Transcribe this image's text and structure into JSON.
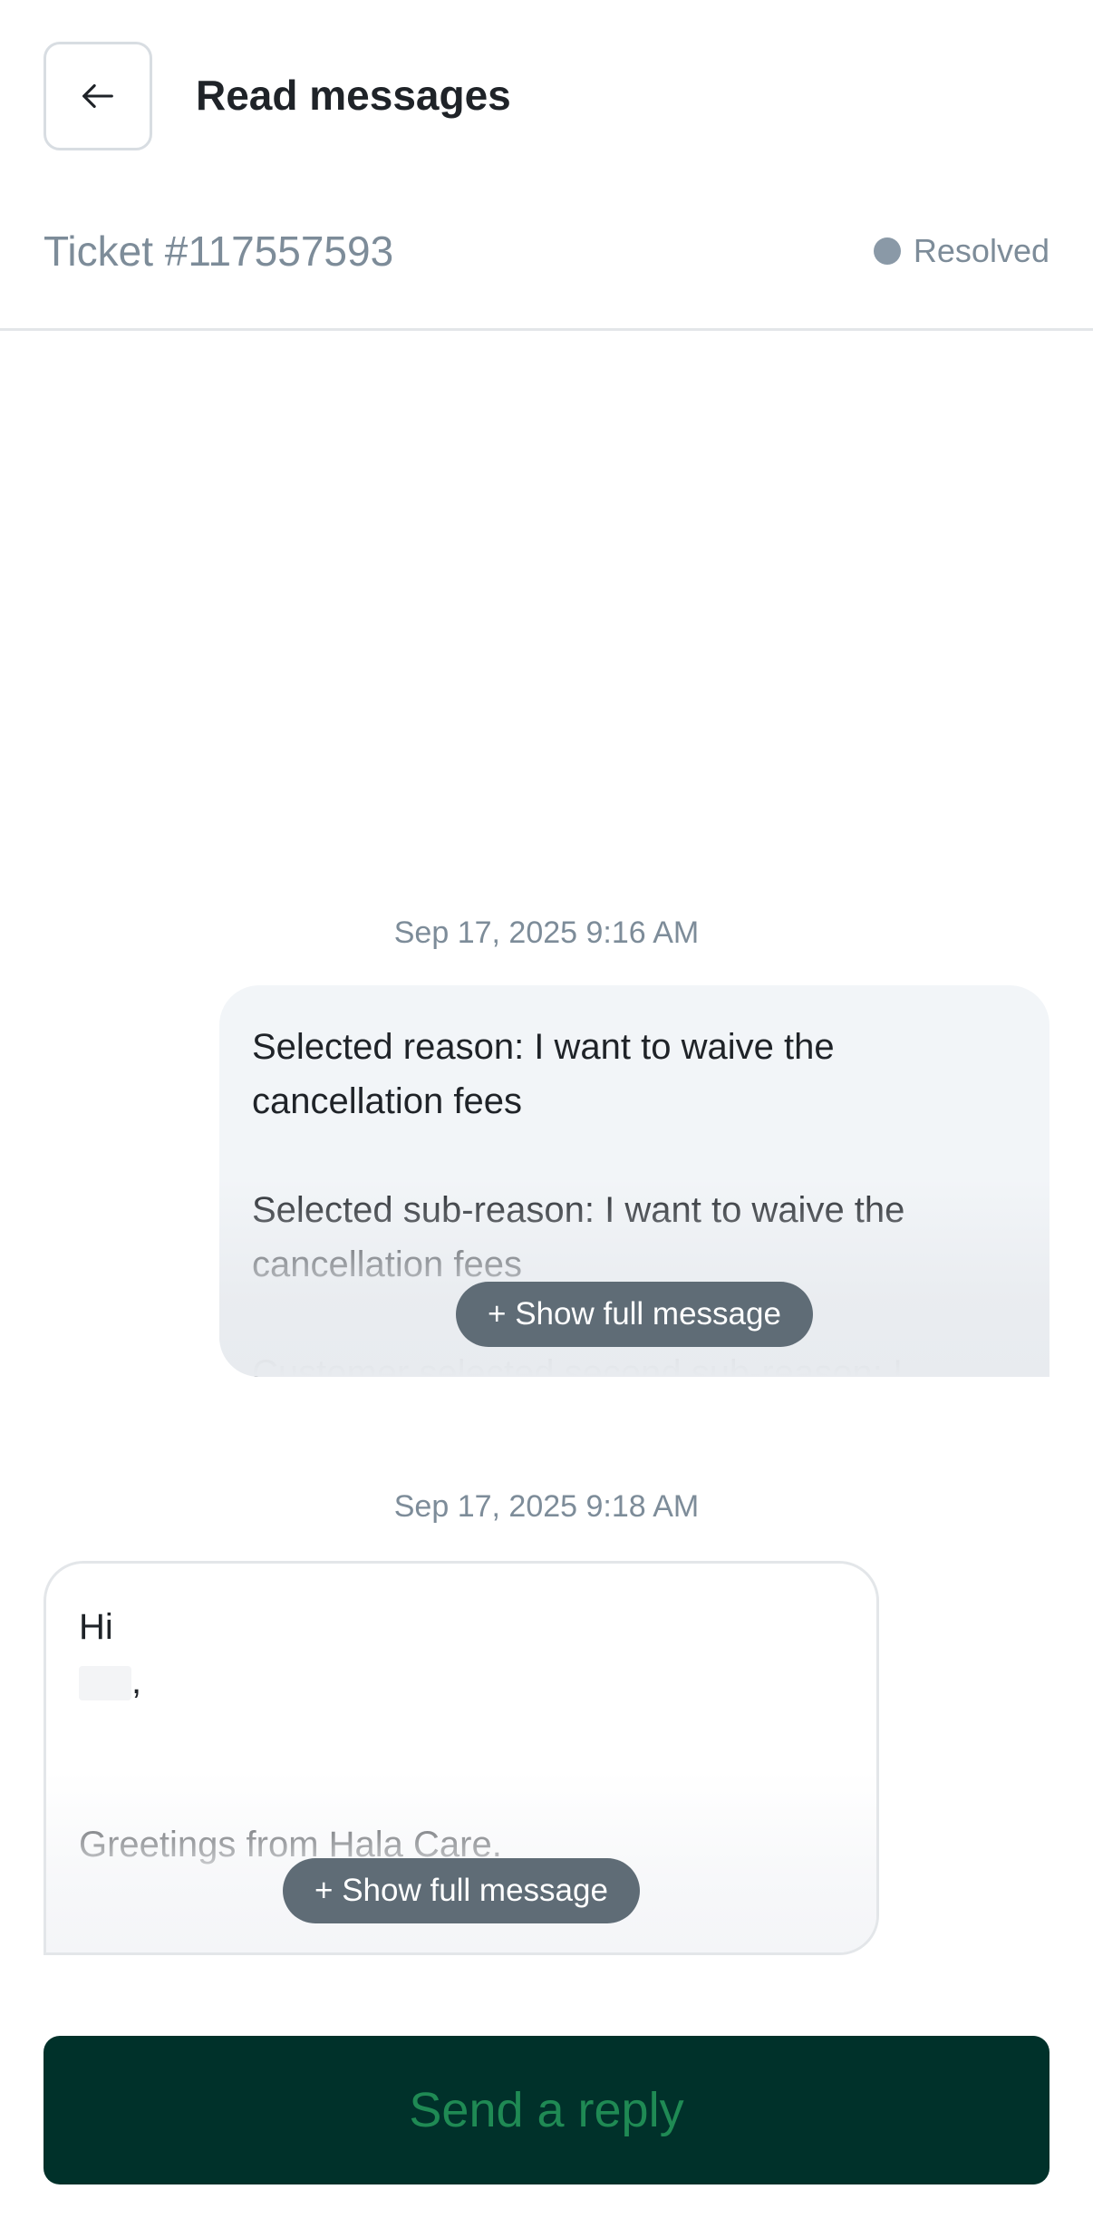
{
  "header": {
    "back_icon": "arrow-left-icon",
    "title": "Read messages"
  },
  "ticket": {
    "id": "Ticket #117557593",
    "status": "Resolved",
    "status_color": "#8a99a7"
  },
  "messages": [
    {
      "timestamp": "Sep 17, 2025 9:16 AM",
      "direction": "outgoing",
      "text": "Selected reason: I want to waive the cancellation fees\n\nSelected sub-reason: I want to waive the cancellation fees\n\nCustomer selected second sub-reason: I",
      "show_full_label": "+ Show full message"
    },
    {
      "timestamp": "Sep 17, 2025 9:18 AM",
      "direction": "incoming",
      "greeting": "Hi",
      "name_suffix": ",",
      "body": "Greetings from Hala Care.",
      "show_full_label": "+ Show full message"
    }
  ],
  "reply_button": {
    "label": "Send a reply",
    "bg_color": "#00312a",
    "text_color": "#1f8a54"
  }
}
